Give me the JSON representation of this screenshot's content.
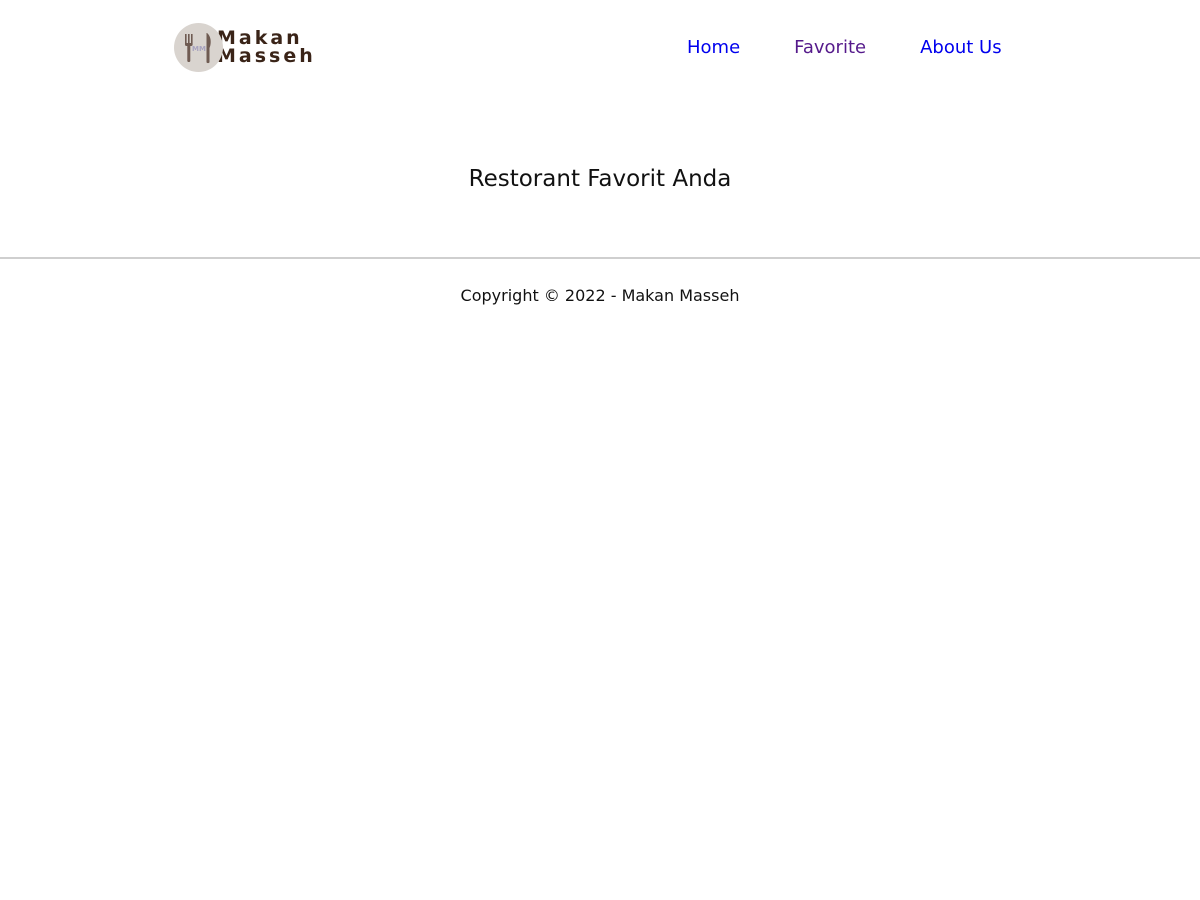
{
  "header": {
    "brand": {
      "line1": "Makan",
      "line2": "Masseh",
      "logo_monogram": "MM",
      "logo_icon": "fork-knife-logo-icon"
    },
    "nav": {
      "items": [
        {
          "label": "Home",
          "state": "link",
          "color": "#0000ee"
        },
        {
          "label": "Favorite",
          "state": "visited",
          "color": "#551a8b"
        },
        {
          "label": "About Us",
          "state": "link",
          "color": "#0000ee"
        }
      ]
    }
  },
  "main": {
    "title": "Restorant Favorit Anda"
  },
  "footer": {
    "copyright": "Copyright © 2022 - Makan Masseh"
  },
  "colors": {
    "brand_text": "#3a2418",
    "logo_bg": "#d9d4cf",
    "divider": "#cfcfcf"
  }
}
